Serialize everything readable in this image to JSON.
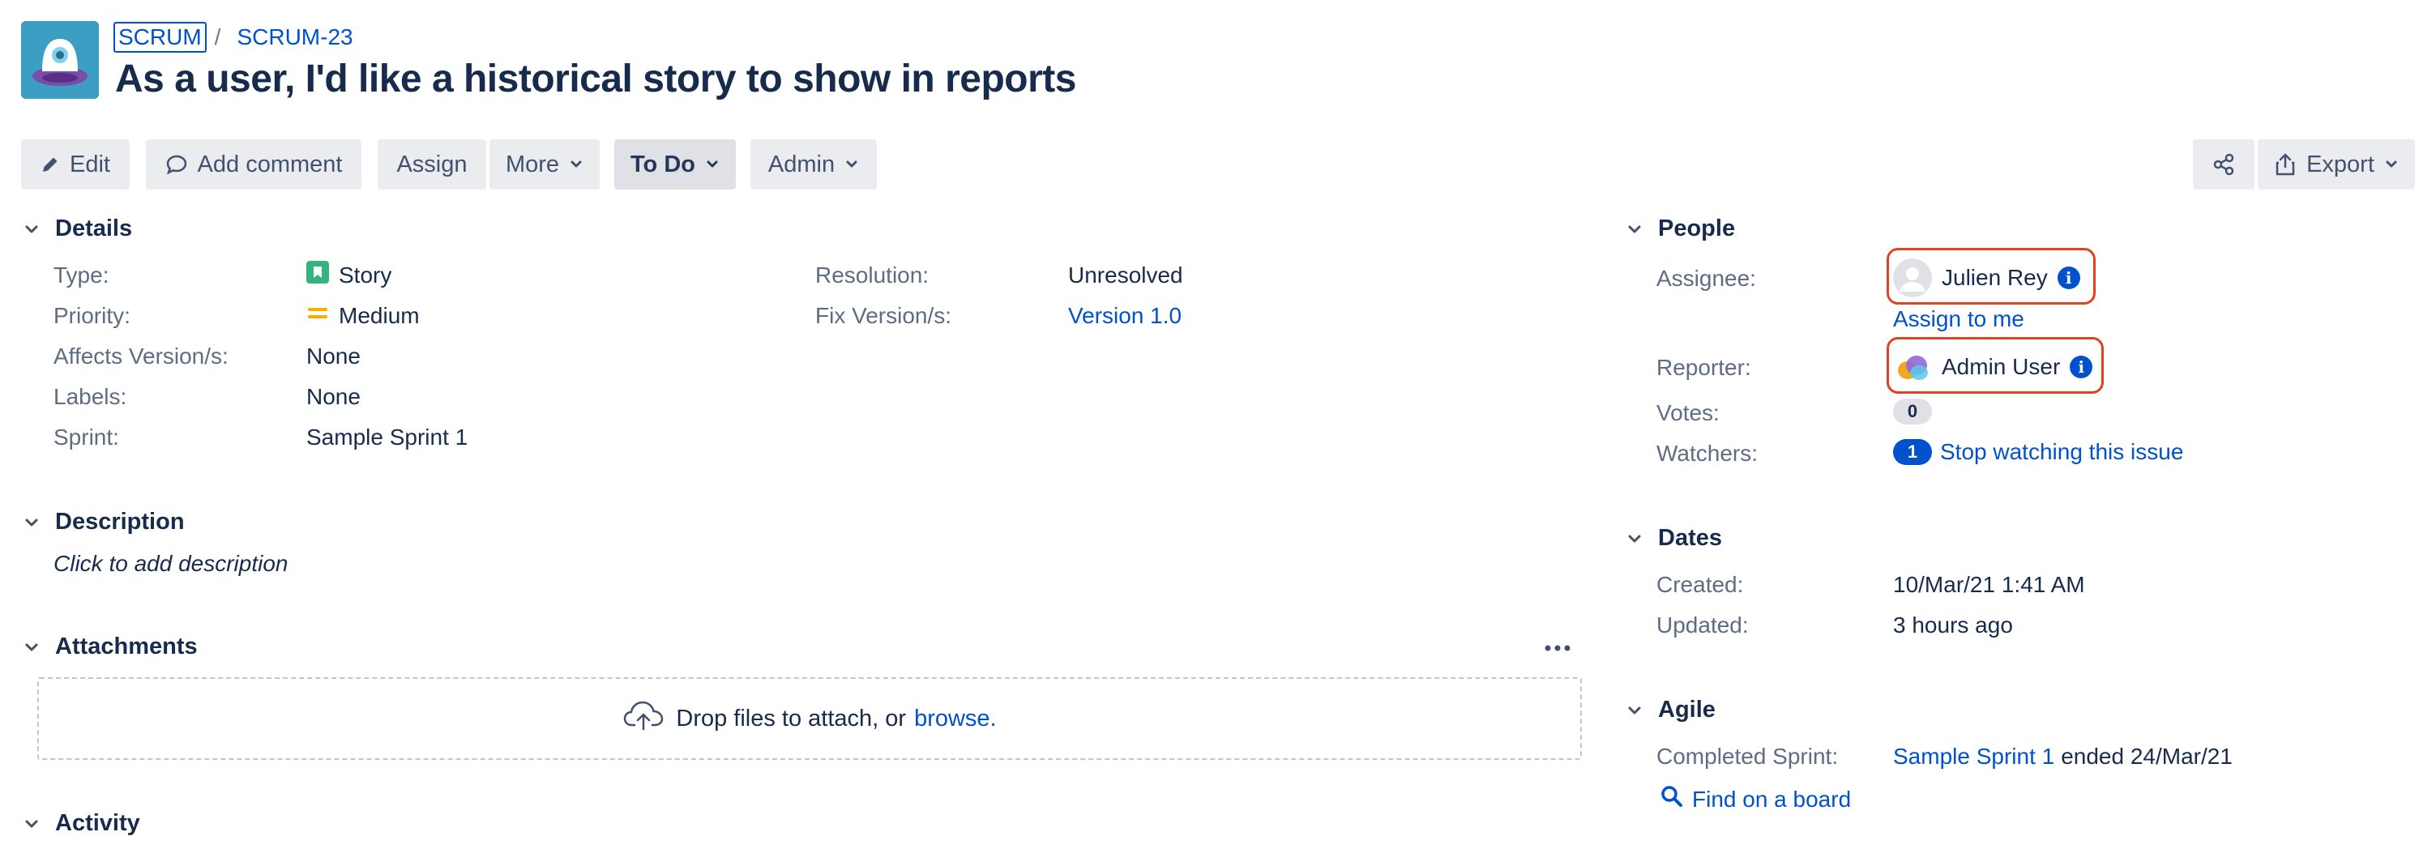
{
  "breadcrumb": {
    "project": "SCRUM",
    "separator": "/",
    "issue_key": "SCRUM-23"
  },
  "issue": {
    "title": "As a user, I'd like a historical story to show in reports"
  },
  "toolbar": {
    "edit": "Edit",
    "add_comment": "Add comment",
    "assign": "Assign",
    "more": "More",
    "status": "To Do",
    "admin": "Admin",
    "export": "Export"
  },
  "details": {
    "heading": "Details",
    "type_label": "Type:",
    "type_value": "Story",
    "priority_label": "Priority:",
    "priority_value": "Medium",
    "affects_label": "Affects Version/s:",
    "affects_value": "None",
    "labels_label": "Labels:",
    "labels_value": "None",
    "sprint_label": "Sprint:",
    "sprint_value": "Sample Sprint 1",
    "resolution_label": "Resolution:",
    "resolution_value": "Unresolved",
    "fix_label": "Fix Version/s:",
    "fix_value": "Version 1.0"
  },
  "description": {
    "heading": "Description",
    "placeholder": "Click to add description"
  },
  "attachments": {
    "heading": "Attachments",
    "drop_text": "Drop files to attach, or",
    "browse": "browse."
  },
  "activity": {
    "heading": "Activity"
  },
  "people": {
    "heading": "People",
    "assignee_label": "Assignee:",
    "assignee_value": "Julien Rey",
    "assign_to_me": "Assign to me",
    "reporter_label": "Reporter:",
    "reporter_value": "Admin User",
    "votes_label": "Votes:",
    "votes_count": "0",
    "watchers_label": "Watchers:",
    "watchers_count": "1",
    "watch_link": "Stop watching this issue",
    "info_glyph": "i"
  },
  "dates": {
    "heading": "Dates",
    "created_label": "Created:",
    "created_value": "10/Mar/21 1:41 AM",
    "updated_label": "Updated:",
    "updated_value": "3 hours ago"
  },
  "agile": {
    "heading": "Agile",
    "completed_label": "Completed Sprint:",
    "completed_sprint": "Sample Sprint 1",
    "completed_suffix": "ended 24/Mar/21",
    "find_on_board": "Find on a board"
  },
  "colors": {
    "link": "#0052cc",
    "story_icon": "#36b37e",
    "priority_medium": "#ffab00",
    "highlight": "#e0431f"
  },
  "icons": [
    "project-avatar",
    "pencil-icon",
    "comment-icon",
    "chevron-down-icon",
    "share-icon",
    "export-icon",
    "story-icon",
    "priority-medium-icon",
    "upload-cloud-icon",
    "more-horizontal-icon",
    "info-icon",
    "user-avatar",
    "search-icon"
  ]
}
